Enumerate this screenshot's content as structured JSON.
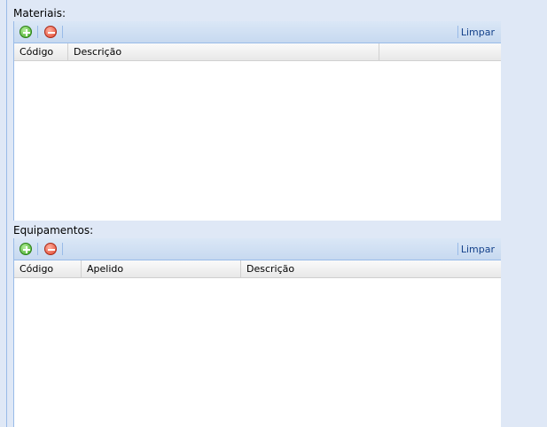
{
  "materials": {
    "label": "Materiais:",
    "clear_label": "Limpar",
    "columns": [
      "Código",
      "Descrição"
    ]
  },
  "equipment": {
    "label": "Equipamentos:",
    "clear_label": "Limpar",
    "columns": [
      "Código",
      "Apelido",
      "Descrição"
    ]
  }
}
